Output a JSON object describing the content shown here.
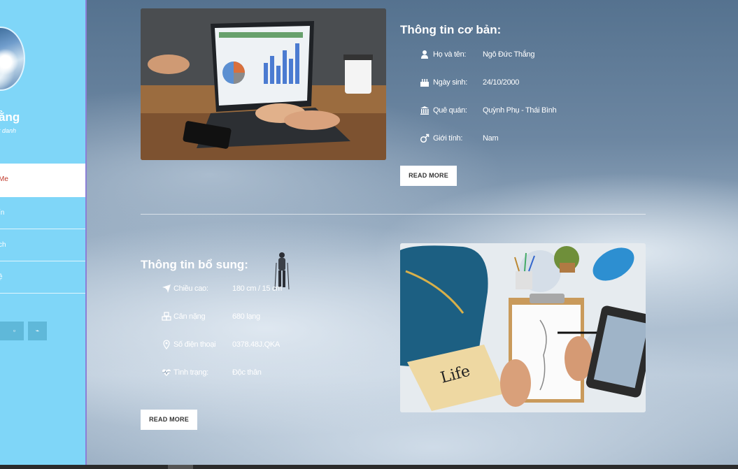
{
  "sidebar": {
    "name": "ằng",
    "nickname": "t danh",
    "nav": [
      {
        "label": "Me",
        "active": true
      },
      {
        "label": "ín",
        "active": false
      },
      {
        "label": "ch",
        "active": false
      },
      {
        "label": "ệ",
        "active": false
      }
    ],
    "social": [
      {
        "icon": "social-icon"
      },
      {
        "icon": "square-icon",
        "glyph": "▫"
      },
      {
        "icon": "rss-icon",
        "glyph": "⌁"
      }
    ]
  },
  "basic": {
    "title": "Thông tin cơ bản:",
    "rows": [
      {
        "icon": "user-icon",
        "label": "Họ và tên:",
        "value": "Ngô Đức Thắng"
      },
      {
        "icon": "birthday-cake-icon",
        "label": "Ngày sinh:",
        "value": "24/10/2000"
      },
      {
        "icon": "bank-icon",
        "label": "Quê quán:",
        "value": "Quỳnh Phụ - Thái Bình"
      },
      {
        "icon": "mars-icon",
        "label": "Giới tính:",
        "value": "Nam"
      }
    ],
    "button": "READ MORE"
  },
  "extra": {
    "title": "Thông tin bổ sung:",
    "rows": [
      {
        "icon": "rocket-icon",
        "label": "Chiều cao:",
        "value": "180 cm / 15 cm"
      },
      {
        "icon": "cubes-icon",
        "label": "Cân nặng",
        "value": "680 lạng"
      },
      {
        "icon": "map-marker-icon",
        "label": "Số điện thoại",
        "value": "0378.48J.QKA"
      },
      {
        "icon": "heartbeat-icon",
        "label": "Tình trạng:",
        "value": "Độc thân"
      }
    ],
    "button": "READ MORE"
  }
}
